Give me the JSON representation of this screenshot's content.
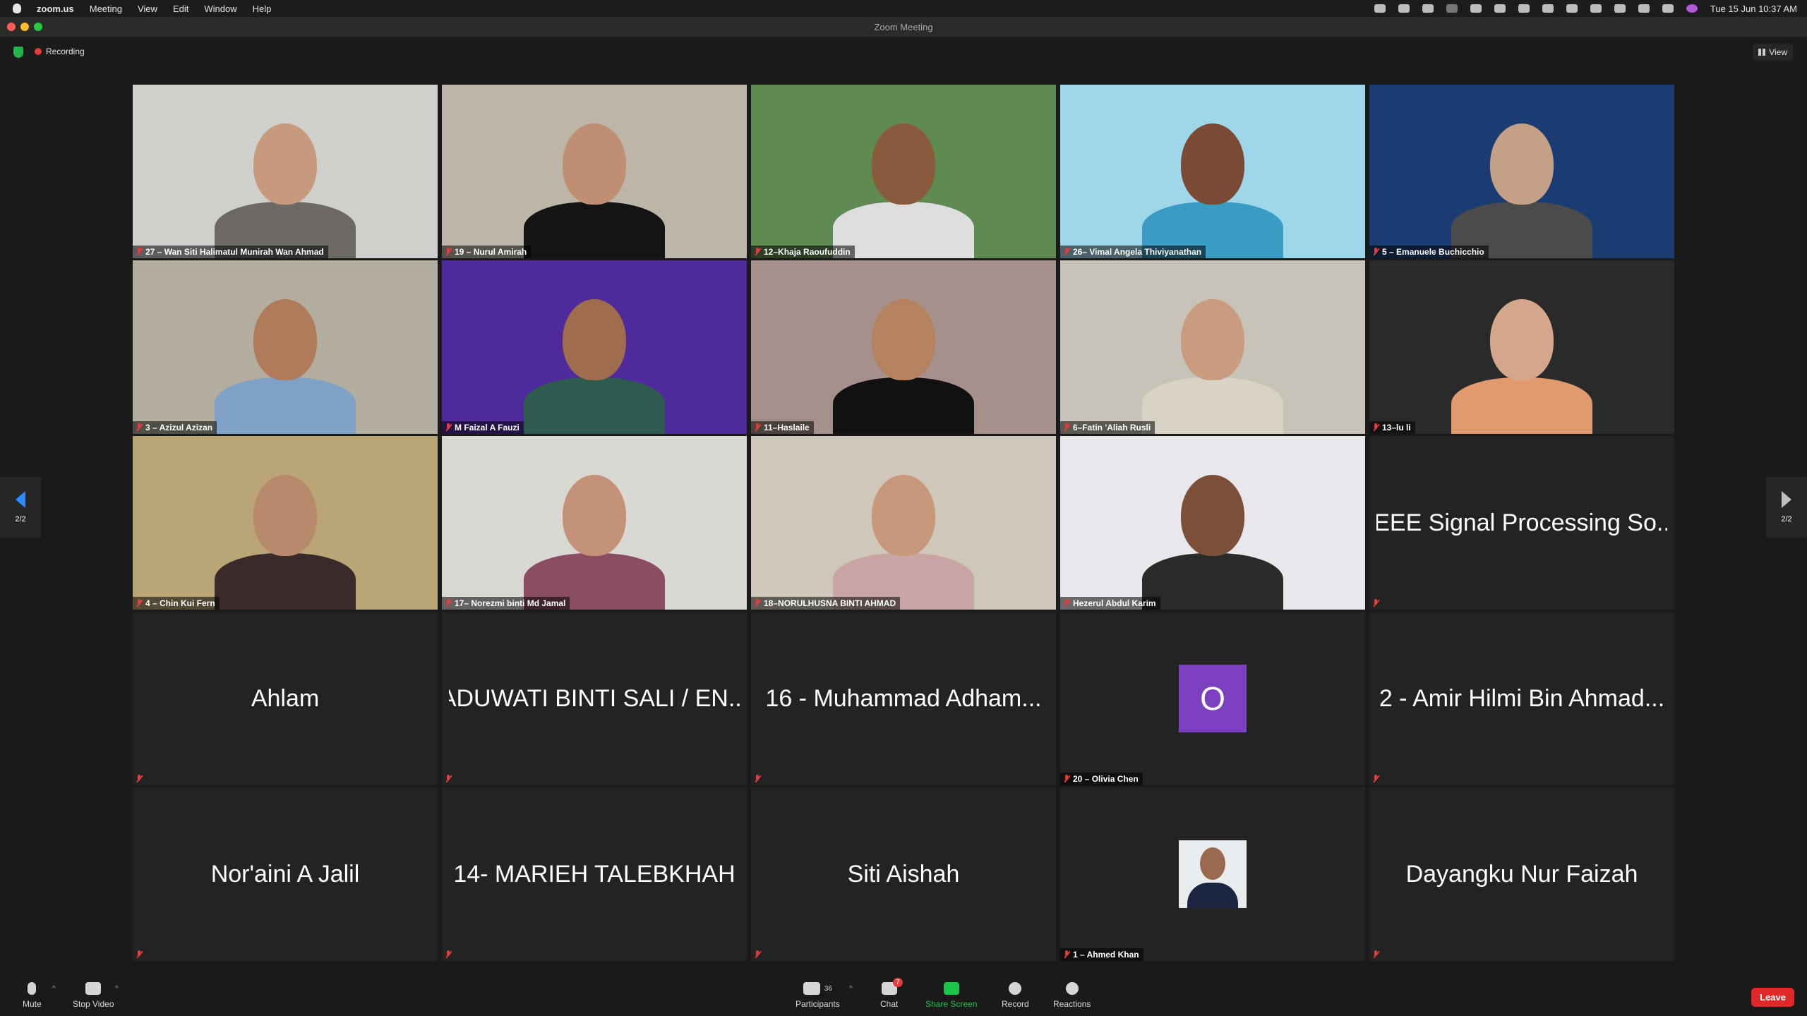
{
  "menubar": {
    "apple": "",
    "app": "zoom.us",
    "items": [
      "Meeting",
      "View",
      "Edit",
      "Window",
      "Help"
    ],
    "clock": "Tue 15 Jun  10:37 AM"
  },
  "window": {
    "title": "Zoom Meeting"
  },
  "top": {
    "recording": "Recording",
    "view": "View"
  },
  "pager": {
    "left": "2/2",
    "right": "2/2"
  },
  "tiles": [
    {
      "name": "27 – Wan Siti Halimatul Munirah Wan Ahmad",
      "bg": "#cfcfcb",
      "skin": "#c79a7e",
      "cloth": "#6d6a66"
    },
    {
      "name": "19 – Nurul Amirah",
      "bg": "#bdb6a8",
      "skin": "#c08f73",
      "cloth": "#141414"
    },
    {
      "name": "12–Khaja Raoufuddin",
      "bg": "#5f8a52",
      "skin": "#8a5a3c",
      "cloth": "#dedede"
    },
    {
      "name": "26– Vimal Angela Thiviyanathan",
      "bg": "#9fd7ea",
      "skin": "#7a4a34",
      "cloth": "#3a9bc3"
    },
    {
      "name": "5 – Emanuele Buchicchio",
      "bg": "#1a3c73",
      "skin": "#c4a087",
      "cloth": "#4b4b4b"
    },
    {
      "name": "3 – Azizul Azizan",
      "bg": "#b3ad9f",
      "skin": "#b07b5b",
      "cloth": "#7fa1c6"
    },
    {
      "name": "M Faizal A Fauzi",
      "bg": "#4e2a9c",
      "skin": "#a06c4e",
      "cloth": "#2f5a4f"
    },
    {
      "name": "11–Haslaile",
      "bg": "#a6908c",
      "skin": "#b5825f",
      "cloth": "#111111"
    },
    {
      "name": "6–Fatin 'Aliah Rusli",
      "bg": "#c7c3b8",
      "skin": "#c99c80",
      "cloth": "#d9d3c5"
    },
    {
      "name": "13–lu li",
      "bg": "#2a2a2a",
      "skin": "#d4a78c",
      "cloth": "#e09a6e"
    },
    {
      "name": "4 – Chin Kui Fern",
      "bg": "#b9a575",
      "skin": "#b78a6c",
      "cloth": "#3a2a2a"
    },
    {
      "name": "17– Norezmi binti Md Jamal",
      "bg": "#d9d8d3",
      "skin": "#c49278",
      "cloth": "#8a4c63"
    },
    {
      "name": "18–NORULHUSNA BINTI AHMAD",
      "bg": "#cfc7bb",
      "skin": "#c8987a",
      "cloth": "#c9a5a5"
    },
    {
      "name": "Hezerul Abdul Karim",
      "bg": "#e7e7ec",
      "skin": "#7c5038",
      "cloth": "#2a2a2a"
    },
    {
      "name": "",
      "display": "IEEE Signal Processing So..."
    },
    {
      "name": "",
      "display": "Ahlam"
    },
    {
      "name": "",
      "display": "ADUWATI BINTI SALI / EN..."
    },
    {
      "name": "",
      "display": "16 - Muhammad Adham..."
    },
    {
      "name": "20 – Olivia Chen",
      "avatar": "O"
    },
    {
      "name": "",
      "display": "2 - Amir Hilmi Bin Ahmad..."
    },
    {
      "name": "",
      "display": "Nor'aini A Jalil"
    },
    {
      "name": "",
      "display": "14- MARIEH TALEBKHAH"
    },
    {
      "name": "",
      "display": "Siti Aishah"
    },
    {
      "name": "1 – Ahmed Khan",
      "photo": true
    },
    {
      "name": "",
      "display": "Dayangku Nur Faizah"
    }
  ],
  "toolbar": {
    "mute": "Mute",
    "stop_video": "Stop Video",
    "participants": "Participants",
    "participants_count": "36",
    "chat": "Chat",
    "chat_badge": "7",
    "share": "Share Screen",
    "record": "Record",
    "reactions": "Reactions",
    "leave": "Leave"
  },
  "colors": {
    "accent": "#2d8cff",
    "share": "#1ec34c",
    "leave": "#e02828",
    "olivia_avatar": "#7b3fbf"
  }
}
